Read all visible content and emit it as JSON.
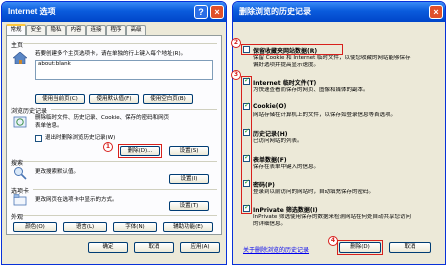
{
  "options_window": {
    "title": "Internet 选项",
    "help_glyph": "?",
    "close_glyph": "×",
    "tabs": [
      "常规",
      "安全",
      "隐私",
      "内容",
      "连接",
      "程序",
      "高级"
    ],
    "home": {
      "label": "主页",
      "desc": "若要创建多个主页选项卡，请在单独的行上键入每个地址(R)。",
      "url": "about:blank",
      "buttons": [
        "使用当前页(C)",
        "使用默认值(F)",
        "使用空白页(B)"
      ]
    },
    "history": {
      "label": "浏览历史记录",
      "desc_line1": "删除临时文件、历史记录、Cookie、保存的密码和网页",
      "desc_line2": "表单信息。",
      "checkbox_label": "退出时删除浏览历史记录(W)",
      "delete_button": "删除(D)...",
      "settings_button": "设置(S)"
    },
    "search": {
      "label": "搜索",
      "desc": "更改搜索默认值。",
      "settings_button": "设置(I)"
    },
    "tabs_group": {
      "label": "选项卡",
      "desc": "更改网页在选项卡中显示的方式。",
      "settings_button": "设置(T)"
    },
    "appearance": {
      "label": "外观",
      "buttons": [
        "颜色(O)",
        "语言(L)",
        "字体(N)",
        "辅助功能(E)"
      ]
    },
    "bottom_buttons": [
      "确定",
      "取消",
      "应用(A)"
    ]
  },
  "delete_window": {
    "title": "删除浏览的历史记录",
    "close_glyph": "×",
    "items": [
      {
        "title": "保留收藏夹网站数据(R)",
        "desc": "保留 Cookie 和 Internet 临时文件，以使您收藏的网站能够保存",
        "desc2": "偏好选项并提高显示速度。",
        "checked": false
      },
      {
        "title": "Internet 临时文件(T)",
        "desc": "为快速查看而保存的网页、图像和媒体的副本。",
        "desc2": "",
        "checked": true
      },
      {
        "title": "Cookie(O)",
        "desc": "网站存储在计算机上的文件，以保存如登录信息等首选项。",
        "desc2": "",
        "checked": true
      },
      {
        "title": "历史记录(H)",
        "desc": "已访问网站的列表。",
        "desc2": "",
        "checked": true
      },
      {
        "title": "表单数据(F)",
        "desc": "保存在表单中键入的信息。",
        "desc2": "",
        "checked": true
      },
      {
        "title": "密码(P)",
        "desc": "登录到以前访问的网站时，自动填充保存的密码。",
        "desc2": "",
        "checked": true
      },
      {
        "title": "InPrivate 筛选数据(I)",
        "desc": "InPrivate 筛选使用保存的数据来检测网站在何处自动共享您访问",
        "desc2": "的详细信息。",
        "checked": true
      }
    ],
    "link": "关于删除浏览的历史记录",
    "delete_button": "删除(D)",
    "cancel_button": "取消"
  },
  "annotations": [
    "1",
    "2",
    "3",
    "4"
  ],
  "colors": {
    "highlight": "#d8201c",
    "title_bar": "#0a5bdc",
    "link": "#0000ee"
  }
}
